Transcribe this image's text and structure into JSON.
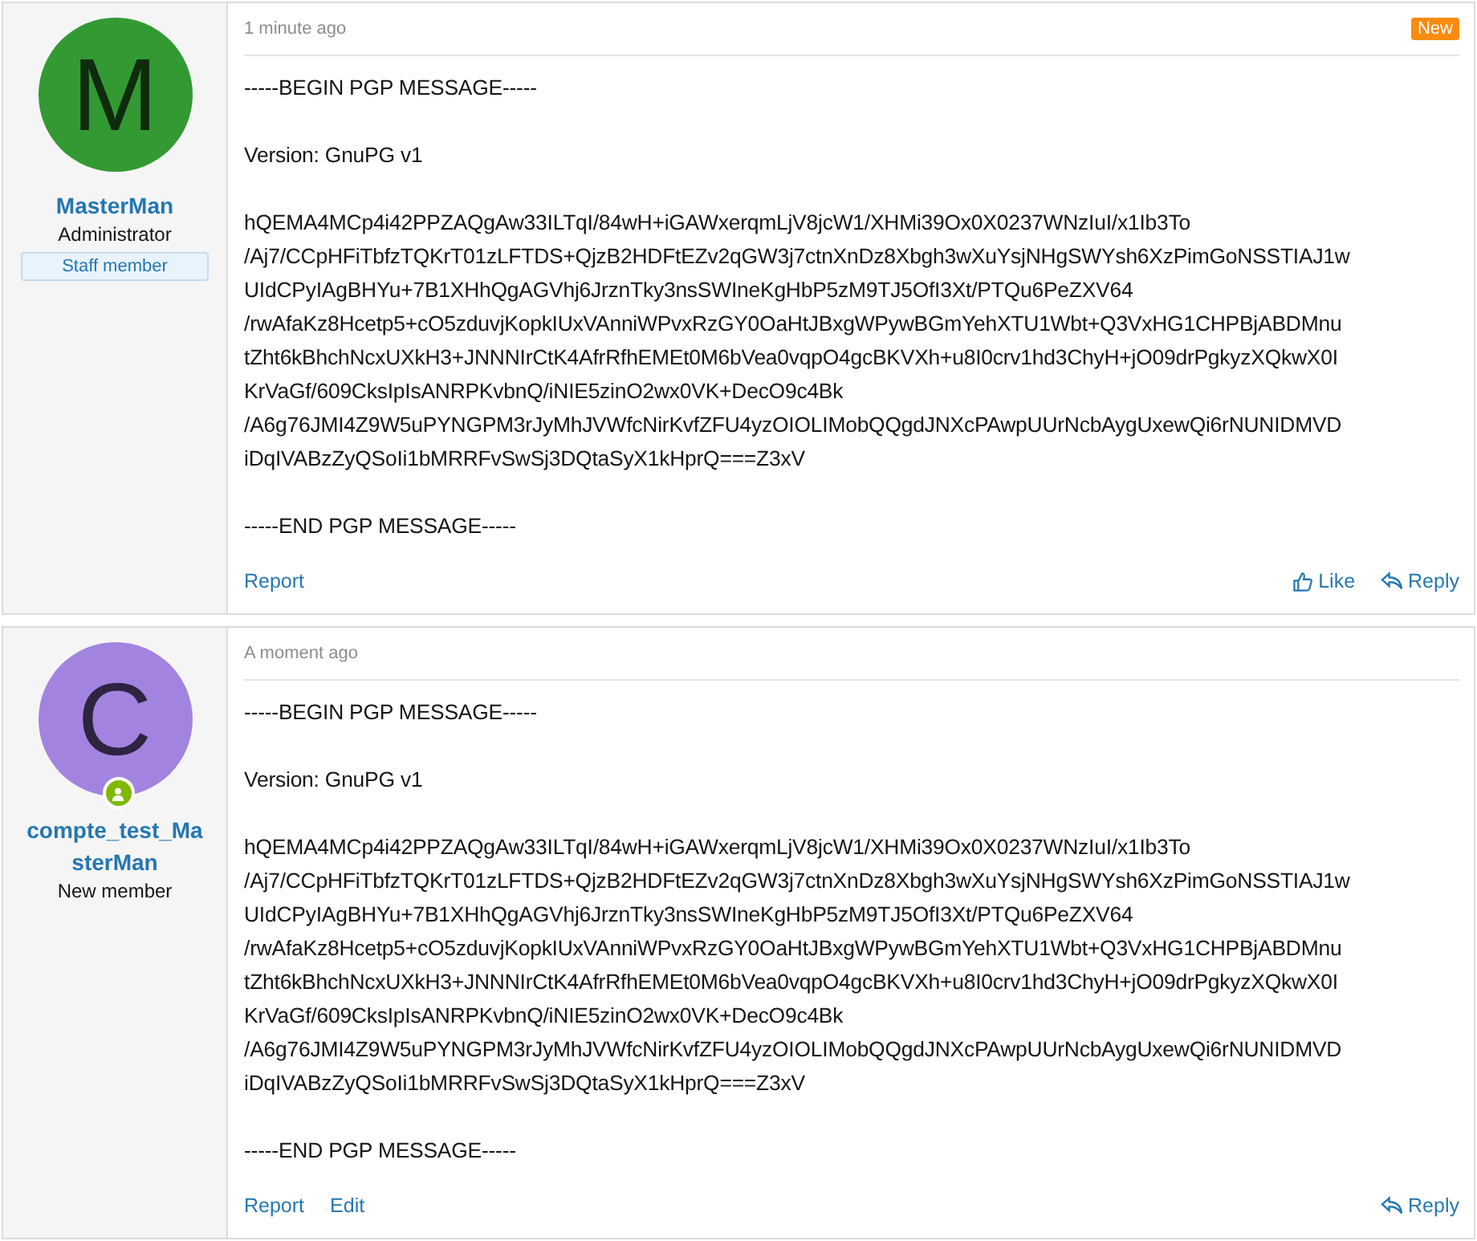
{
  "posts": [
    {
      "author": "MasterMan",
      "avatar_letter": "M",
      "color": "#339933",
      "user_title": "Administrator",
      "banner": "Staff member",
      "online": false,
      "time": "1 minute ago",
      "new_label": "New",
      "paragraphs": [
        [
          "-----BEGIN PGP MESSAGE-----"
        ],
        [
          "Version: GnuPG v1"
        ],
        [
          "hQEMA4MCp4i42PPZAQgAw33ILTqI/84wH+iGAWxerqmLjV8jcW1/XHMi39Ox0X0237WNzIuI/x1Ib3To",
          "/Aj7/CCpHFiTbfzTQKrT01zLFTDS+QjzB2HDFtEZv2qGW3j7ctnXnDz8Xbgh3wXuYsjNHgSWYsh6XzPimGoNSSTIAJ1w",
          "UIdCPyIAgBHYu+7B1XHhQgAGVhj6JrznTky3nsSWIneKgHbP5zM9TJ5OfI3Xt/PTQu6PeZXV64",
          "/rwAfaKz8Hcetp5+cO5zduvjKopkIUxVAnniWPvxRzGY0OaHtJBxgWPywBGmYehXTU1Wbt+Q3VxHG1CHPBjABDMnu",
          "tZht6kBhchNcxUXkH3+JNNNIrCtK4AfrRfhEMEt0M6bVea0vqpO4gcBKVXh+u8I0crv1hd3ChyH+jO09drPgkyzXQkwX0I",
          "KrVaGf/609CksIpIsANRPKvbnQ/iNIE5zinO2wx0VK+DecO9c4Bk",
          "/A6g76JMI4Z9W5uPYNGPM3rJyMhJVWfcNirKvfZFU4yzOIOLIMobQQgdJNXcPAwpUUrNcbAygUxewQi6rNUNIDMVD",
          "iDqIVABzZyQSoIi1bMRRFvSwSj3DQtaSyX1kHprQ===Z3xV"
        ],
        [
          "-----END PGP MESSAGE-----"
        ]
      ],
      "left_actions": [
        "Report"
      ],
      "right_actions": [
        {
          "kind": "like",
          "label": "Like"
        },
        {
          "kind": "reply",
          "label": "Reply"
        }
      ]
    },
    {
      "author": "compte_test_MasterMan",
      "avatar_letter": "C",
      "color": "#a383e0",
      "user_title": "New member",
      "online": true,
      "time": "A moment ago",
      "paragraphs": [
        [
          "-----BEGIN PGP MESSAGE-----"
        ],
        [
          "Version: GnuPG v1"
        ],
        [
          "hQEMA4MCp4i42PPZAQgAw33ILTqI/84wH+iGAWxerqmLjV8jcW1/XHMi39Ox0X0237WNzIuI/x1Ib3To",
          "/Aj7/CCpHFiTbfzTQKrT01zLFTDS+QjzB2HDFtEZv2qGW3j7ctnXnDz8Xbgh3wXuYsjNHgSWYsh6XzPimGoNSSTIAJ1w",
          "UIdCPyIAgBHYu+7B1XHhQgAGVhj6JrznTky3nsSWIneKgHbP5zM9TJ5OfI3Xt/PTQu6PeZXV64",
          "/rwAfaKz8Hcetp5+cO5zduvjKopkIUxVAnniWPvxRzGY0OaHtJBxgWPywBGmYehXTU1Wbt+Q3VxHG1CHPBjABDMnu",
          "tZht6kBhchNcxUXkH3+JNNNIrCtK4AfrRfhEMEt0M6bVea0vqpO4gcBKVXh+u8I0crv1hd3ChyH+jO09drPgkyzXQkwX0I",
          "KrVaGf/609CksIpIsANRPKvbnQ/iNIE5zinO2wx0VK+DecO9c4Bk",
          "/A6g76JMI4Z9W5uPYNGPM3rJyMhJVWfcNirKvfZFU4yzOIOLIMobQQgdJNXcPAwpUUrNcbAygUxewQi6rNUNIDMVD",
          "iDqIVABzZyQSoIi1bMRRFvSwSj3DQtaSyX1kHprQ===Z3xV"
        ],
        [
          "-----END PGP MESSAGE-----"
        ]
      ],
      "left_actions": [
        "Report",
        "Edit"
      ],
      "right_actions": [
        {
          "kind": "reply",
          "label": "Reply"
        }
      ]
    }
  ]
}
